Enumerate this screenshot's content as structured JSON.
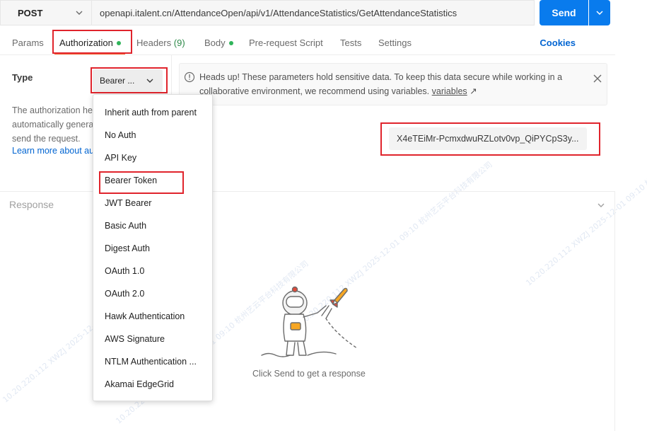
{
  "request": {
    "method": "POST",
    "url": "openapi.italent.cn/AttendanceOpen/api/v1/AttendanceStatistics/GetAttendanceStatistics",
    "send_label": "Send"
  },
  "tabs": [
    {
      "label": "Params"
    },
    {
      "label": "Authorization"
    },
    {
      "label": "Headers",
      "count": "(9)"
    },
    {
      "label": "Body"
    },
    {
      "label": "Pre-request Script"
    },
    {
      "label": "Tests"
    },
    {
      "label": "Settings"
    }
  ],
  "cookies_label": "Cookies",
  "auth": {
    "type_label": "Type",
    "type_value": "Bearer ...",
    "description_lines": [
      "The authorization he",
      "automatically genera",
      "send the request."
    ],
    "learn_more": "Learn more about au",
    "notice_text": "Heads up! These parameters hold sensitive data. To keep this data secure while working in a collaborative environment, we recommend using variables.",
    "notice_link": "variables",
    "notice_arrow": "↗",
    "token_value": "X4eTEiMr-PcmxdwuRZLotv0vp_QiPYCpS3y..."
  },
  "dropdown": {
    "options": [
      "Inherit auth from parent",
      "No Auth",
      "API Key",
      "Bearer Token",
      "JWT Bearer",
      "Basic Auth",
      "Digest Auth",
      "OAuth 1.0",
      "OAuth 2.0",
      "Hawk Authentication",
      "AWS Signature",
      "NTLM Authentication ...",
      "Akamai EdgeGrid"
    ]
  },
  "response": {
    "label": "Response",
    "empty_message": "Click Send to get a response"
  },
  "watermark": "10.20.220.112 XWZJ 2025-12-01 09:10 杭州艺云平台科技有限公司",
  "colors": {
    "accent": "#ff6c37",
    "send": "#097bed",
    "link": "#0265d2",
    "highlight": "#e0242c",
    "status_dot": "#2fb45a"
  }
}
